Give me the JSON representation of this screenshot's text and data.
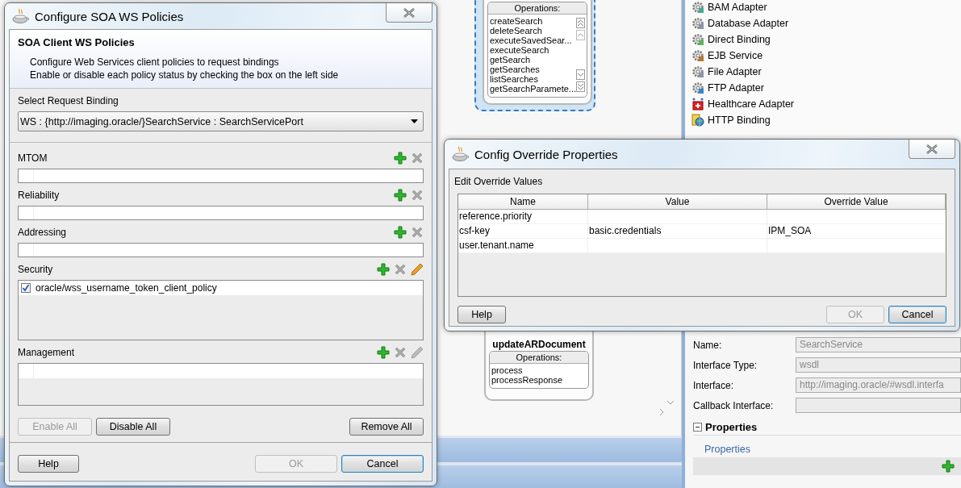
{
  "canvas": {
    "nodes": [
      {
        "selected": true,
        "operations_label": "Operations:",
        "operations": [
          "createSearch",
          "deleteSearch",
          "executeSavedSear...",
          "executeSearch",
          "getSearch",
          "getSearches",
          "listSearches",
          "getSearchParamete..."
        ]
      },
      {
        "title": "updateARDocument",
        "selected": false,
        "operations_label": "Operations:",
        "operations": [
          "process",
          "processResponse"
        ]
      }
    ]
  },
  "palette": {
    "items": [
      "BAM Adapter",
      "Database Adapter",
      "Direct Binding",
      "EJB Service",
      "File Adapter",
      "FTP Adapter",
      "Healthcare Adapter",
      "HTTP Binding"
    ]
  },
  "properties_panel": {
    "fields": [
      {
        "label": "Name:",
        "value": "SearchService",
        "disabled": true
      },
      {
        "label": "Interface Type:",
        "value": "wsdl",
        "disabled": true
      },
      {
        "label": "Interface:",
        "value": "http://imaging.oracle/#wsdl.interfa",
        "disabled": true
      },
      {
        "label": "Callback Interface:",
        "disabled": true
      }
    ],
    "section": "Properties",
    "subsection": "Properties"
  },
  "soa_dialog": {
    "title": "Configure SOA WS Policies",
    "header": {
      "title": "SOA Client WS Policies",
      "lines": [
        "Configure Web Services client policies to request bindings",
        "Enable or disable each policy status by checking the box on the left side"
      ]
    },
    "binding": {
      "label": "Select Request Binding",
      "value": "WS : {http://imaging.oracle/}SearchService : SearchServicePort"
    },
    "sections": [
      {
        "label": "MTOM",
        "kind": "single",
        "tools": [
          {
            "kind": "add",
            "disabled": false
          },
          {
            "kind": "remove",
            "disabled": true
          }
        ]
      },
      {
        "label": "Reliability",
        "kind": "single",
        "tools": [
          {
            "kind": "add",
            "disabled": false
          },
          {
            "kind": "remove",
            "disabled": true
          }
        ]
      },
      {
        "label": "Addressing",
        "kind": "single",
        "tools": [
          {
            "kind": "add",
            "disabled": false
          },
          {
            "kind": "remove",
            "disabled": true
          }
        ]
      },
      {
        "label": "Security",
        "kind": "list",
        "tools": [
          {
            "kind": "add",
            "disabled": false
          },
          {
            "kind": "remove",
            "disabled": true
          },
          {
            "kind": "edit",
            "disabled": false
          }
        ],
        "policies": [
          {
            "name": "oracle/wss_username_token_client_policy",
            "checked": true
          }
        ]
      },
      {
        "label": "Management",
        "kind": "list",
        "tools": [
          {
            "kind": "add",
            "disabled": false
          },
          {
            "kind": "remove",
            "disabled": true
          },
          {
            "kind": "edit",
            "disabled": true
          }
        ]
      }
    ],
    "actions": [
      {
        "label": "Enable All",
        "disabled": true
      },
      {
        "label": "Disable All",
        "disabled": false
      },
      {
        "label": "Remove All",
        "disabled": false
      }
    ],
    "footer": [
      {
        "label": "Help",
        "disabled": false,
        "default": false
      },
      {
        "label": "OK",
        "disabled": true,
        "default": false
      },
      {
        "label": "Cancel",
        "disabled": false,
        "default": true
      }
    ]
  },
  "override_dialog": {
    "title": "Config Override Properties",
    "section_label": "Edit Override Values",
    "columns": [
      "Name",
      "Value",
      "Override Value"
    ],
    "rows": [
      [
        "reference.priority",
        "",
        ""
      ],
      [
        "csf-key",
        "basic.credentials",
        "IPM_SOA"
      ],
      [
        "user.tenant.name",
        "",
        ""
      ]
    ],
    "footer": [
      {
        "label": "Help",
        "disabled": false,
        "default": false
      },
      {
        "label": "OK",
        "disabled": true,
        "default": false
      },
      {
        "label": "Cancel",
        "disabled": false,
        "default": true
      }
    ]
  }
}
